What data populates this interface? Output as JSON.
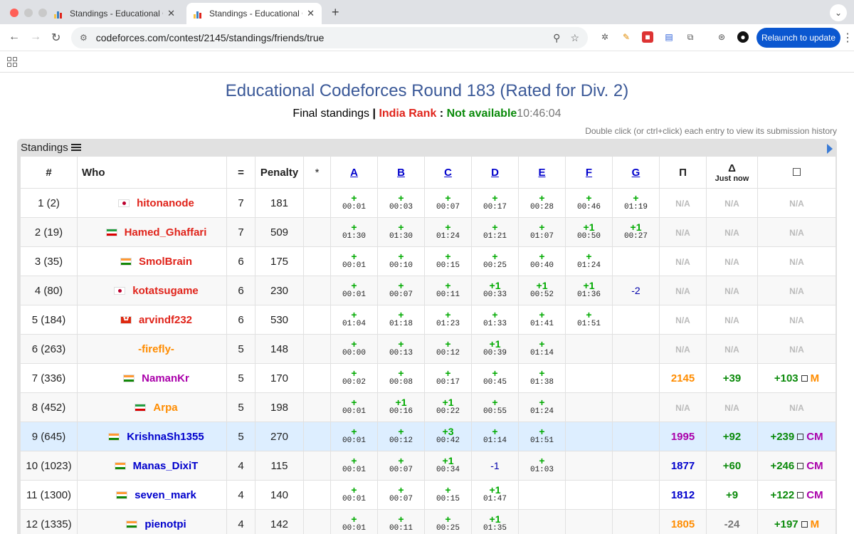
{
  "browser": {
    "tabs": [
      {
        "title": "Standings - Educational Code",
        "active": false
      },
      {
        "title": "Standings - Educational Code",
        "active": true
      }
    ],
    "url": "codeforces.com/contest/2145/standings/friends/true",
    "relaunch_label": "Relaunch to update"
  },
  "page": {
    "title": "Educational Codeforces Round 183 (Rated for Div. 2)",
    "final_standings": "Final standings",
    "separator": "|",
    "rank_label": "India Rank",
    "colon": ":",
    "rank_value": "Not available",
    "time": "10:46:04",
    "hint": "Double click (or ctrl+click) each entry to view its submission history",
    "panel_title": "Standings"
  },
  "table": {
    "headers": {
      "rank": "#",
      "who": "Who",
      "solved": "=",
      "penalty": "Penalty",
      "hacks": "*",
      "problems": [
        "A",
        "B",
        "C",
        "D",
        "E",
        "F",
        "G"
      ],
      "perf": "Π",
      "delta": "Δ",
      "delta_sub": "Just now",
      "total": "☐"
    },
    "rows": [
      {
        "rank": "1 (2)",
        "flag": "jp",
        "name": "hitonanode",
        "color": "red",
        "solved": "7",
        "penalty": "181",
        "cells": [
          [
            "+",
            "00:01"
          ],
          [
            "+",
            "00:03"
          ],
          [
            "+",
            "00:07"
          ],
          [
            "+",
            "00:17"
          ],
          [
            "+",
            "00:28"
          ],
          [
            "+",
            "00:46"
          ],
          [
            "+",
            "01:19"
          ]
        ],
        "perf": "N/A",
        "delta": "N/A",
        "total": "N/A",
        "total_rank": ""
      },
      {
        "rank": "2 (19)",
        "flag": "ir",
        "name": "Hamed_Ghaffari",
        "color": "red",
        "solved": "7",
        "penalty": "509",
        "cells": [
          [
            "+",
            "01:30"
          ],
          [
            "+",
            "01:30"
          ],
          [
            "+",
            "01:24"
          ],
          [
            "+",
            "01:21"
          ],
          [
            "+",
            "01:07"
          ],
          [
            "+1",
            "00:50"
          ],
          [
            "+1",
            "00:27"
          ]
        ],
        "perf": "N/A",
        "delta": "N/A",
        "total": "N/A",
        "total_rank": ""
      },
      {
        "rank": "3 (35)",
        "flag": "in",
        "name": "SmolBrain",
        "color": "red",
        "solved": "6",
        "penalty": "175",
        "cells": [
          [
            "+",
            "00:01"
          ],
          [
            "+",
            "00:10"
          ],
          [
            "+",
            "00:15"
          ],
          [
            "+",
            "00:25"
          ],
          [
            "+",
            "00:40"
          ],
          [
            "+",
            "01:24"
          ],
          [
            "",
            ""
          ]
        ],
        "perf": "N/A",
        "delta": "N/A",
        "total": "N/A",
        "total_rank": ""
      },
      {
        "rank": "4 (80)",
        "flag": "jp",
        "name": "kotatsugame",
        "color": "red-k",
        "solved": "6",
        "penalty": "230",
        "cells": [
          [
            "+",
            "00:01"
          ],
          [
            "+",
            "00:07"
          ],
          [
            "+",
            "00:11"
          ],
          [
            "+1",
            "00:33"
          ],
          [
            "+1",
            "00:52"
          ],
          [
            "+1",
            "01:36"
          ],
          [
            "-2",
            ""
          ]
        ],
        "perf": "N/A",
        "delta": "N/A",
        "total": "N/A",
        "total_rank": ""
      },
      {
        "rank": "5 (184)",
        "flag": "hk",
        "name": "arvindf232",
        "color": "red-k",
        "solved": "6",
        "penalty": "530",
        "cells": [
          [
            "+",
            "01:04"
          ],
          [
            "+",
            "01:18"
          ],
          [
            "+",
            "01:23"
          ],
          [
            "+",
            "01:33"
          ],
          [
            "+",
            "01:41"
          ],
          [
            "+",
            "01:51"
          ],
          [
            "",
            ""
          ]
        ],
        "perf": "N/A",
        "delta": "N/A",
        "total": "N/A",
        "total_rank": ""
      },
      {
        "rank": "6 (263)",
        "flag": "",
        "name": "-firefly-",
        "color": "orange",
        "solved": "5",
        "penalty": "148",
        "cells": [
          [
            "+",
            "00:00"
          ],
          [
            "+",
            "00:13"
          ],
          [
            "+",
            "00:12"
          ],
          [
            "+1",
            "00:39"
          ],
          [
            "+",
            "01:14"
          ],
          [
            "",
            ""
          ],
          [
            "",
            ""
          ]
        ],
        "perf": "N/A",
        "delta": "N/A",
        "total": "N/A",
        "total_rank": ""
      },
      {
        "rank": "7 (336)",
        "flag": "in",
        "name": "NamanKr",
        "color": "violet",
        "solved": "5",
        "penalty": "170",
        "cells": [
          [
            "+",
            "00:02"
          ],
          [
            "+",
            "00:08"
          ],
          [
            "+",
            "00:17"
          ],
          [
            "+",
            "00:45"
          ],
          [
            "+",
            "01:38"
          ],
          [
            "",
            ""
          ],
          [
            "",
            ""
          ]
        ],
        "perf": "2145",
        "delta": "+39",
        "total": "+103",
        "total_rank": "M"
      },
      {
        "rank": "8 (452)",
        "flag": "ir",
        "name": "Arpa",
        "color": "orange",
        "solved": "5",
        "penalty": "198",
        "cells": [
          [
            "+",
            "00:01"
          ],
          [
            "+1",
            "00:16"
          ],
          [
            "+1",
            "00:22"
          ],
          [
            "+",
            "00:55"
          ],
          [
            "+",
            "01:24"
          ],
          [
            "",
            ""
          ],
          [
            "",
            ""
          ]
        ],
        "perf": "N/A",
        "delta": "N/A",
        "total": "N/A",
        "total_rank": ""
      },
      {
        "rank": "9 (645)",
        "flag": "in",
        "name": "KrishnaSh1355",
        "color": "blue",
        "solved": "5",
        "penalty": "270",
        "cells": [
          [
            "+",
            "00:01"
          ],
          [
            "+",
            "00:12"
          ],
          [
            "+3",
            "00:42"
          ],
          [
            "+",
            "01:14"
          ],
          [
            "+",
            "01:51"
          ],
          [
            "",
            ""
          ],
          [
            "",
            ""
          ]
        ],
        "perf": "1995",
        "delta": "+92",
        "total": "+239",
        "total_rank": "CM"
      },
      {
        "rank": "10 (1023)",
        "flag": "in",
        "name": "Manas_DixiT",
        "color": "blue",
        "solved": "4",
        "penalty": "115",
        "cells": [
          [
            "+",
            "00:01"
          ],
          [
            "+",
            "00:07"
          ],
          [
            "+1",
            "00:34"
          ],
          [
            "-1",
            ""
          ],
          [
            "+",
            "01:03"
          ],
          [
            "",
            ""
          ],
          [
            "",
            ""
          ]
        ],
        "perf": "1877",
        "delta": "+60",
        "total": "+246",
        "total_rank": "CM"
      },
      {
        "rank": "11 (1300)",
        "flag": "in",
        "name": "seven_mark",
        "color": "blue",
        "solved": "4",
        "penalty": "140",
        "cells": [
          [
            "+",
            "00:01"
          ],
          [
            "+",
            "00:07"
          ],
          [
            "+",
            "00:15"
          ],
          [
            "+1",
            "01:47"
          ],
          [
            "",
            ""
          ],
          [
            "",
            ""
          ],
          [
            "",
            ""
          ]
        ],
        "perf": "1812",
        "delta": "+9",
        "total": "+122",
        "total_rank": "CM"
      },
      {
        "rank": "12 (1335)",
        "flag": "in",
        "name": "pienotpi",
        "color": "blue",
        "solved": "4",
        "penalty": "142",
        "cells": [
          [
            "+",
            "00:01"
          ],
          [
            "+",
            "00:11"
          ],
          [
            "+",
            "00:25"
          ],
          [
            "+1",
            "01:35"
          ],
          [
            "",
            ""
          ],
          [
            "",
            ""
          ],
          [
            "",
            ""
          ]
        ],
        "perf": "1805",
        "delta": "-24",
        "total": "+197",
        "total_rank": "M"
      }
    ]
  },
  "colors": {
    "accent": "#3b5998",
    "accepted": "#00aa00",
    "highlight_row": "#ddeeff",
    "relaunch": "#0b57d0"
  }
}
